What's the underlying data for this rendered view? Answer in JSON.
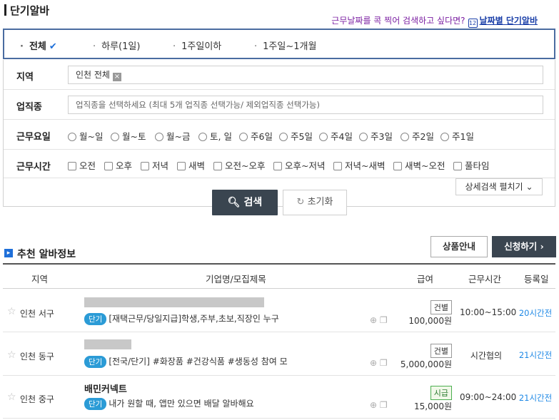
{
  "page": {
    "title": "단기알바"
  },
  "promo": {
    "text": "근무날짜를 콕 찍어 검색하고 싶다면?",
    "icon": "calendar-icon",
    "link": "날짜별 단기알바",
    "calendar_day": "12"
  },
  "periods": [
    {
      "label": "전체",
      "active": true
    },
    {
      "label": "하루(1일)",
      "active": false
    },
    {
      "label": "1주일이하",
      "active": false
    },
    {
      "label": "1주일~1개월",
      "active": false
    }
  ],
  "filters": {
    "region": {
      "label": "지역",
      "value": "인천 전체"
    },
    "job_type": {
      "label": "업직종",
      "placeholder": "업직종을 선택하세요 (최대 5개 업직종 선택가능/ 제외업직종 선택가능)"
    },
    "work_days": {
      "label": "근무요일",
      "options": [
        "월~일",
        "월~토",
        "월~금",
        "토, 일",
        "주6일",
        "주5일",
        "주4일",
        "주3일",
        "주2일",
        "주1일"
      ]
    },
    "work_hours": {
      "label": "근무시간",
      "options": [
        "오전",
        "오후",
        "저녁",
        "새벽",
        "오전~오후",
        "오후~저녁",
        "저녁~새벽",
        "새벽~오전",
        "풀타임"
      ]
    }
  },
  "buttons": {
    "detail_search": "상세검색 펼치기",
    "search": "검색",
    "reset": "초기화",
    "product_info": "상품안내",
    "apply": "신청하기"
  },
  "recommend": {
    "title": "추천 알바정보"
  },
  "table": {
    "headers": [
      "지역",
      "기업명/모집제목",
      "급여",
      "근무시간",
      "등록일"
    ],
    "rows": [
      {
        "region": "인천 서구",
        "company": "",
        "tag": "단기",
        "title": "[재택근무/당일지급]학생,주부,초보,직장인 누구",
        "pay_type": "건별",
        "pay": "100,000원",
        "time": "10:00~15:00",
        "registered": "20시간전"
      },
      {
        "region": "인천 동구",
        "company": "",
        "tag": "단기",
        "title": "[전국/단기] #화장품 #건강식품 #생동성 참여 모",
        "pay_type": "건별",
        "pay": "5,000,000원",
        "time": "시간협의",
        "registered": "21시간전"
      },
      {
        "region": "인천 중구",
        "company": "배민커넥트",
        "tag": "단기",
        "title": "내가 원할 때, 앱만 있으면 배달 알바해요",
        "pay_type": "시급",
        "pay": "15,000원",
        "time": "09:00~24:00",
        "registered": "21시간전"
      }
    ]
  },
  "colors": {
    "accent": "#1e6fd9",
    "dark_button": "#3a4550",
    "tag": "#2b9bd6",
    "promo": "#7b1fa2",
    "period_border": "#4a6ca0"
  }
}
